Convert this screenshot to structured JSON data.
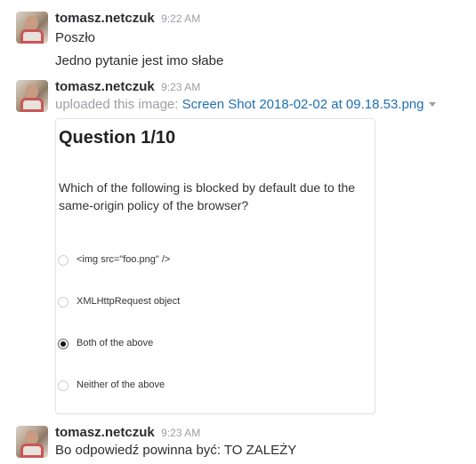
{
  "messages": [
    {
      "author": "tomasz.netczuk",
      "time": "9:22 AM",
      "lines": [
        "Poszło",
        "Jedno pytanie jest imo słabe"
      ]
    },
    {
      "author": "tomasz.netczuk",
      "time": "9:23 AM",
      "upload_prefix": "uploaded this image:",
      "file_name": "Screen Shot 2018-02-02 at 09.18.53.png",
      "attachment": {
        "title": "Question 1/10",
        "question": "Which of the following is blocked by default due to the same-origin policy of the browser?",
        "options": [
          {
            "label": "<img src=\"foo.png\" />",
            "checked": false
          },
          {
            "label": "XMLHttpRequest object",
            "checked": false
          },
          {
            "label": "Both of the above",
            "checked": true
          },
          {
            "label": "Neither of the above",
            "checked": false
          }
        ]
      }
    },
    {
      "author": "tomasz.netczuk",
      "time": "9:23 AM",
      "lines": [
        "Bo odpowiedź powinna być: TO ZALEŻY"
      ]
    }
  ],
  "icons": {
    "avatar": "user-avatar",
    "dropdown": "caret-down-icon",
    "radio": "radio-button"
  }
}
